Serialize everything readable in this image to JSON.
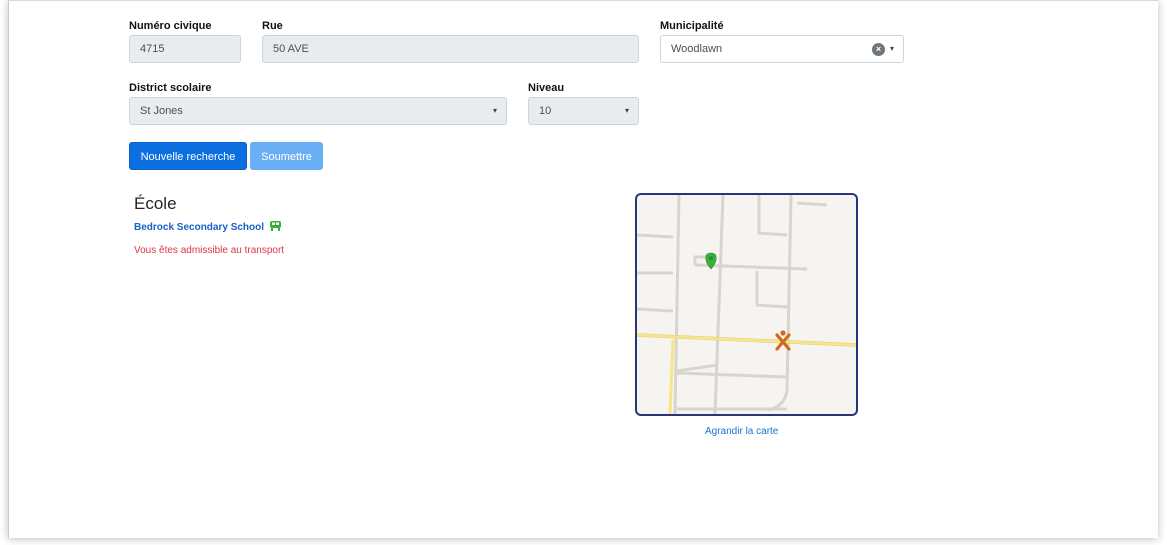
{
  "form": {
    "civic_number": {
      "label": "Numéro civique",
      "value": "4715"
    },
    "street": {
      "label": "Rue",
      "value": "50 AVE"
    },
    "municipality": {
      "label": "Municipalité",
      "value": "Woodlawn",
      "clear": "×",
      "caret": "▾"
    },
    "school_district": {
      "label": "District scolaire",
      "value": "St Jones",
      "caret": "▾"
    },
    "level": {
      "label": "Niveau",
      "value": "10",
      "caret": "▾"
    }
  },
  "buttons": {
    "new_search": "Nouvelle recherche",
    "submit": "Soumettre"
  },
  "result": {
    "heading": "École",
    "school_name": "Bedrock Secondary School",
    "eligibility": "Vous êtes admissible au transport"
  },
  "map": {
    "enlarge_label": "Agrandir la carte"
  },
  "colors": {
    "primary": "#0b6fe0",
    "primary_disabled": "#6aaef5",
    "eligibility_text": "#dc3545",
    "school_link": "#1761c8",
    "map_border": "#29357a",
    "road_minor": "#d9d4cd",
    "road_major": "#f7e58c",
    "home_pin": "#3ab03a",
    "school_marker": "#d2691e",
    "bus_icon": "#3ab03a"
  },
  "icons": {
    "bus": "bus-icon",
    "home_pin": "map-pin-icon",
    "school_marker": "school-marker-icon"
  }
}
